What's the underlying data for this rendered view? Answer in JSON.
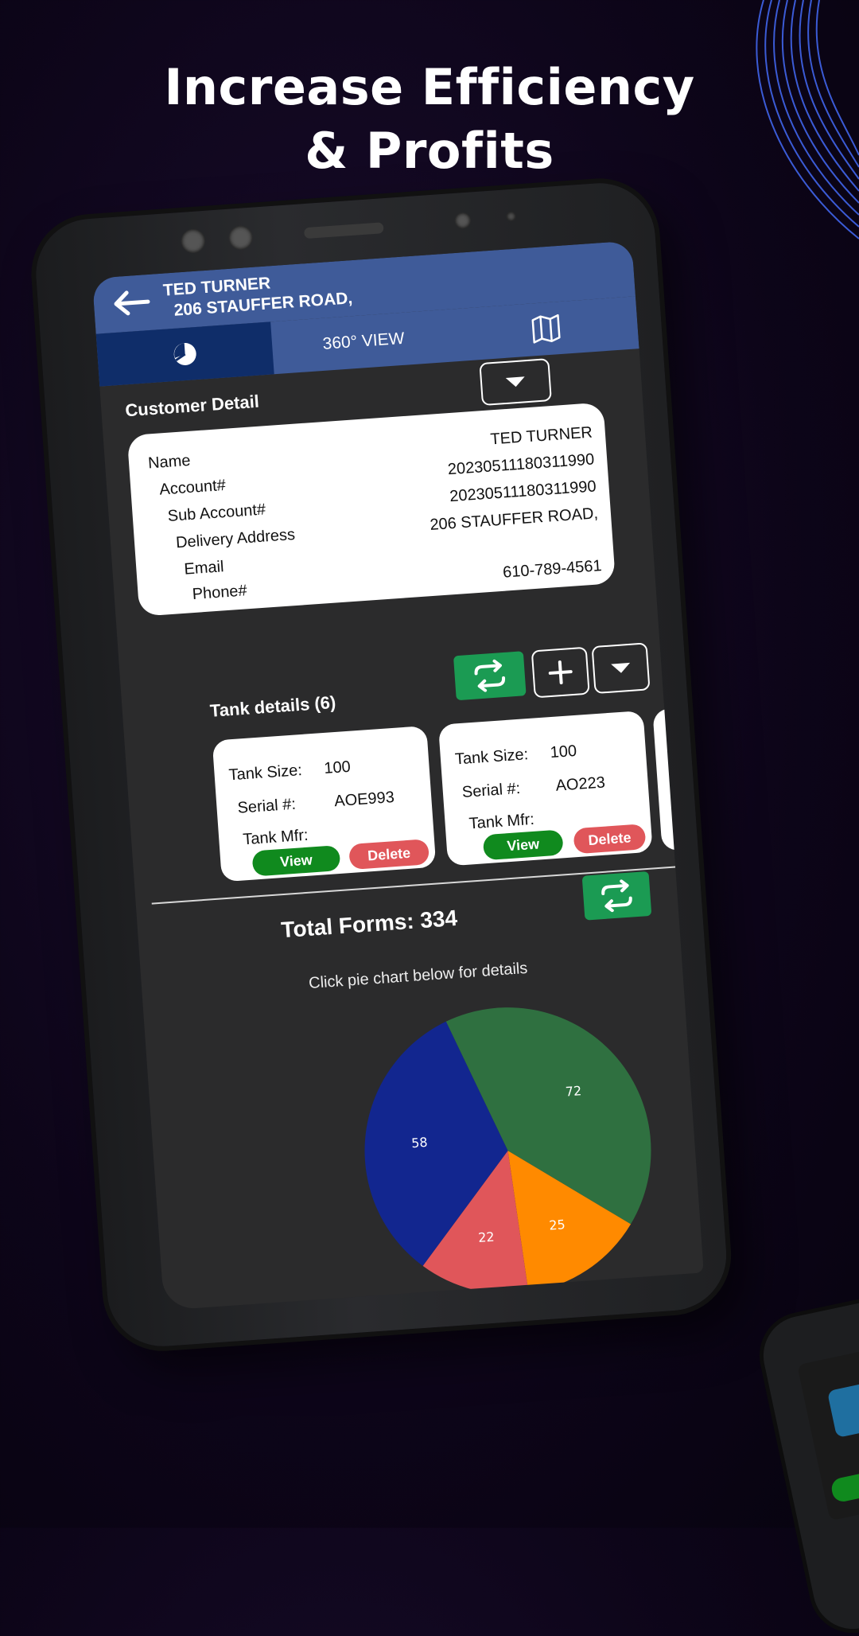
{
  "headline": {
    "line1": "Increase Efficiency",
    "line2": "& Profits"
  },
  "header": {
    "customer_name": "TED TURNER",
    "customer_address": "206 STAUFFER ROAD,"
  },
  "tabs": [
    {
      "id": "chart",
      "icon": "pie-chart-icon",
      "label": ""
    },
    {
      "id": "360",
      "label": "360° VIEW"
    },
    {
      "id": "map",
      "icon": "map-icon",
      "label": ""
    }
  ],
  "customer_detail": {
    "title": "Customer Detail",
    "rows": [
      {
        "label": "Name",
        "value": "TED TURNER"
      },
      {
        "label": "Account#",
        "value": "20230511180311990"
      },
      {
        "label": "Sub Account#",
        "value": "20230511180311990"
      },
      {
        "label": "Delivery Address",
        "value": "206 STAUFFER ROAD,"
      },
      {
        "label": "Email",
        "value": ""
      },
      {
        "label": "Phone#",
        "value": "610-789-4561"
      }
    ]
  },
  "tank_details": {
    "title": "Tank details (6)",
    "tanks": [
      {
        "size_label": "Tank Size:",
        "size": "100",
        "serial_label": "Serial #:",
        "serial": "AOE993",
        "mfr_label": "Tank Mfr:",
        "mfr": "",
        "view": "View",
        "delete": "Delete"
      },
      {
        "size_label": "Tank Size:",
        "size": "100",
        "serial_label": "Serial #:",
        "serial": "AO223",
        "mfr_label": "Tank Mfr:",
        "mfr": "",
        "view": "View",
        "delete": "Delete"
      }
    ]
  },
  "forms": {
    "total": "Total Forms: 334",
    "hint": "Click pie chart below for details"
  },
  "chart_data": {
    "type": "pie",
    "slices": [
      {
        "value": 72,
        "label": "72",
        "color": "#2f7040"
      },
      {
        "value": 25,
        "label": "25",
        "color": "#ff8a00"
      },
      {
        "value": 22,
        "label": "22",
        "color": "#e0565a"
      },
      {
        "value": 58,
        "label": "58",
        "color": "#12268f"
      }
    ],
    "extra_colors": [
      "#f0b060",
      "#5a1a6a"
    ]
  },
  "colors": {
    "header_blue": "#3f5b99",
    "active_tab": "#0f2d69",
    "green": "#1b9b53",
    "view_green": "#108a1e",
    "delete_red": "#e0565a"
  }
}
